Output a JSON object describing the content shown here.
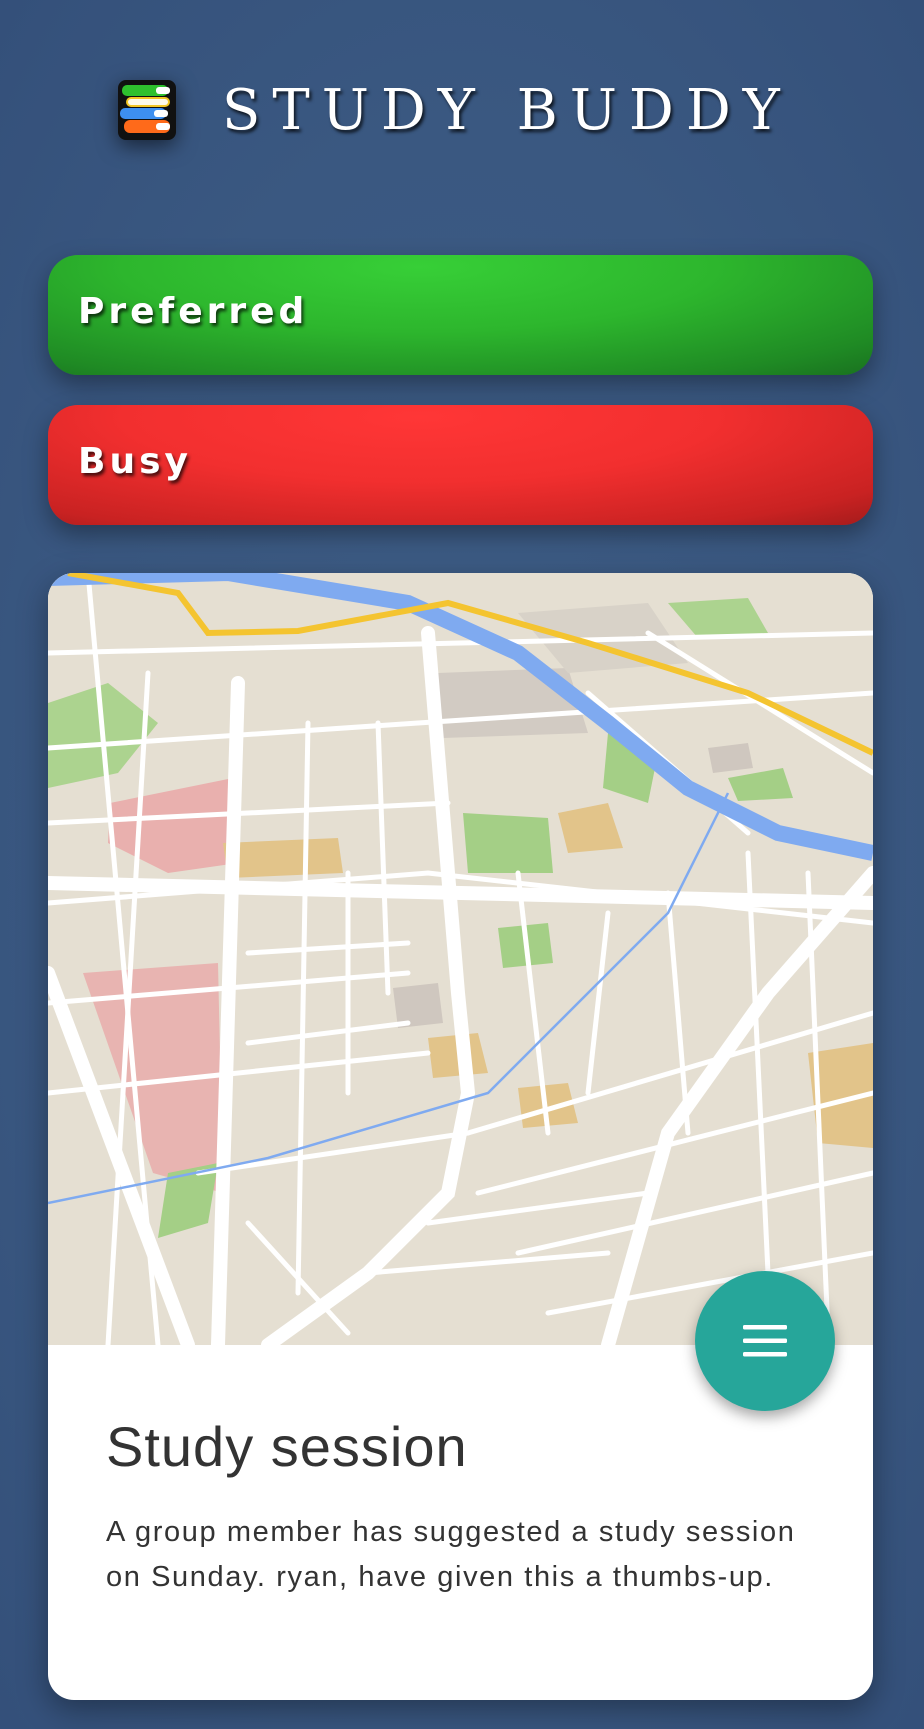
{
  "header": {
    "app_title": "STUDY BUDDY",
    "logo_icon": "books-stack-icon"
  },
  "status_buttons": {
    "preferred_label": "Preferred",
    "busy_label": "Busy",
    "preferred_color": "#2db62d",
    "busy_color": "#f22f2f"
  },
  "card": {
    "map_image": "city-map-image",
    "fab_icon": "menu-icon",
    "fab_color": "#26a69a",
    "title": "Study session",
    "text": "A group member has suggested a study session on Sunday. ryan, have given this a thumbs-up."
  },
  "colors": {
    "background": "#3b5a82",
    "card_background": "#ffffff",
    "text": "#333333"
  }
}
